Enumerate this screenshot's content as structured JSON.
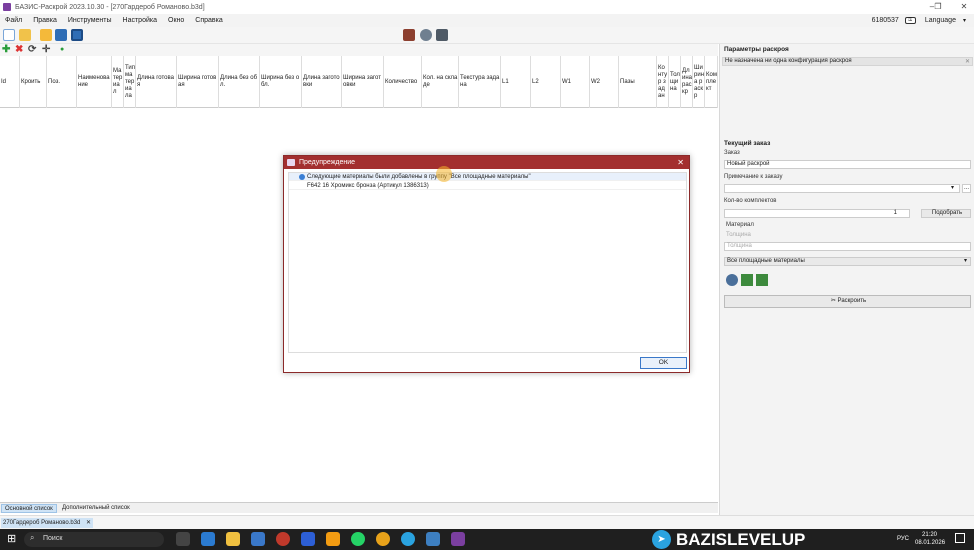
{
  "titlebar": {
    "title": "БАЗИС-Раскрой 2023.10.30 - [270Гардероб Романово.b3d]"
  },
  "window_controls": {
    "minimize": "–",
    "restore": "❐",
    "close": "✕"
  },
  "menu": {
    "items": [
      "Файл",
      "Правка",
      "Инструменты",
      "Настройка",
      "Окно",
      "Справка"
    ],
    "license_number": "6180537",
    "language": "Language"
  },
  "grid": {
    "columns": [
      "Id",
      "Кроить",
      "Поз.",
      "Наименование",
      "Материал",
      "Тип материала",
      "Длина готовая",
      "Ширина готовая",
      "Длина без обл.",
      "Ширина без обл.",
      "Длина заготовки",
      "Ширина заготовки",
      "Количество",
      "Кол. на складе",
      "Текстура задана",
      "L1",
      "L2",
      "W1",
      "W2",
      "Пазы",
      "Контур задан",
      "Толщина",
      "Длина раскр",
      "Ширина раскр",
      "Комплект"
    ]
  },
  "right_panel": {
    "params_title": "Параметры раскроя",
    "config_status": "Не назначена ни одна конфигурация раскроя",
    "current_order_title": "Текущий заказ",
    "order_label": "Заказ",
    "order_value": "Новый раскрой",
    "note_label": "Примечание к заказу",
    "note_value": "",
    "browse_label": "...",
    "kits_label": "Кол-во комплектов",
    "kits_value": "1",
    "pick_button": "Подобрать",
    "material_label": "Материал",
    "thickness_placeholder": "Толщина",
    "material_filter": "Все площадные материалы",
    "cut_button": "Раскроить"
  },
  "bottom_tabs": {
    "main": "Основной список",
    "extra": "Дополнительный список"
  },
  "document_tab": {
    "label": "270Гардероб Романово.b3d",
    "close": "✕"
  },
  "dialog": {
    "title": "Предупреждение",
    "message": "Следующие материалы были добавлены в группу \"Все площадные материалы\"",
    "item": "F642 16 Хромикс бронза (Артикул 1386313)",
    "ok_label": "OK",
    "close_label": "✕"
  },
  "taskbar": {
    "search_placeholder": "Поиск",
    "language": "РУС",
    "time": "21:20",
    "date": "08.01.2026",
    "watermark": "BAZISLEVELUP"
  }
}
